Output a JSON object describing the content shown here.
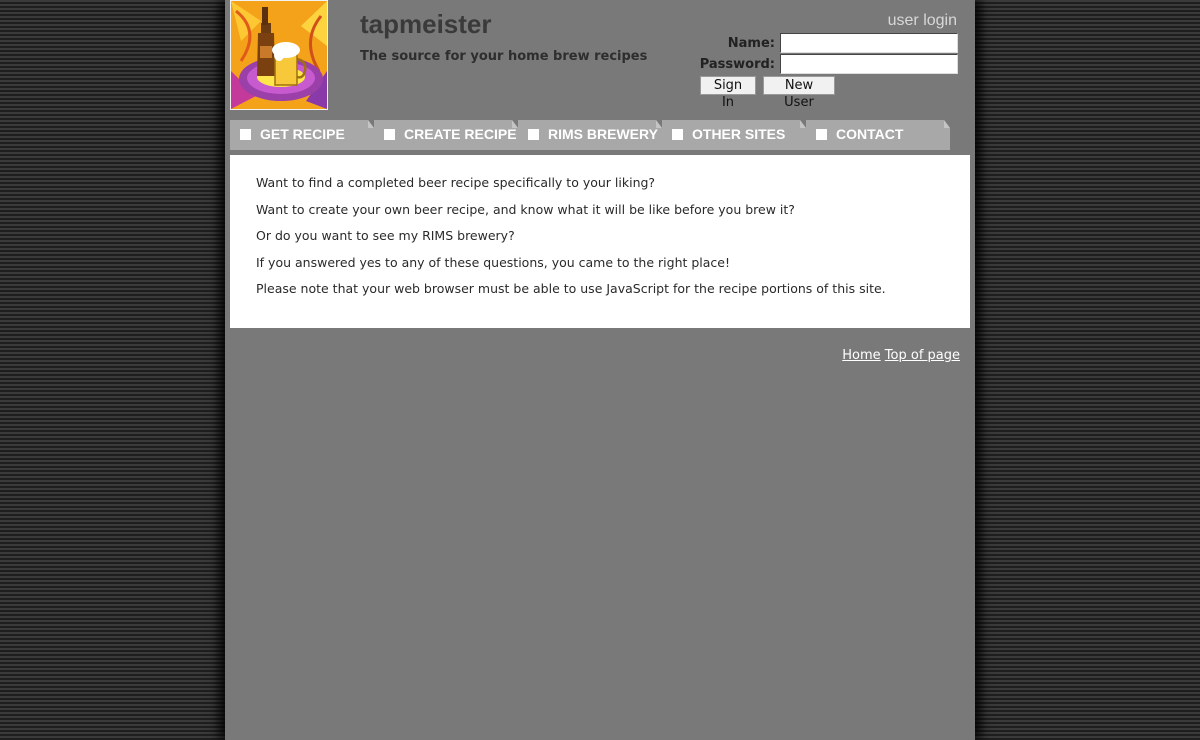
{
  "header": {
    "title": "tapmeister",
    "tagline": "The source for your home brew recipes"
  },
  "login": {
    "title": "user login",
    "name_label": "Name:",
    "password_label": "Password:",
    "name_value": "",
    "password_value": "",
    "sign_in_label": "Sign In",
    "new_user_label": "New User"
  },
  "nav": {
    "tabs": [
      {
        "label": "GET RECIPE"
      },
      {
        "label": "CREATE RECIPE"
      },
      {
        "label": "RIMS BREWERY"
      },
      {
        "label": "OTHER SITES"
      },
      {
        "label": "CONTACT"
      }
    ]
  },
  "content": {
    "paragraphs": [
      "Want to find a completed beer recipe specifically to your liking?",
      "Want to create your own beer recipe, and know what it will be like before you brew it?",
      "Or do you want to see my RIMS brewery?",
      "If you answered yes to any of these questions, you came to the right place!",
      "Please note that your web browser must be able to use JavaScript for the recipe portions of this site."
    ]
  },
  "footer": {
    "home_label": "Home",
    "top_label": "Top of page"
  },
  "colors": {
    "page_background": "#797979",
    "tab_background": "#a8a8a8",
    "content_background": "#ffffff"
  },
  "icons": {
    "logo": "beer-mug-and-bottle-logo",
    "tab_marker": "white-square-icon"
  }
}
